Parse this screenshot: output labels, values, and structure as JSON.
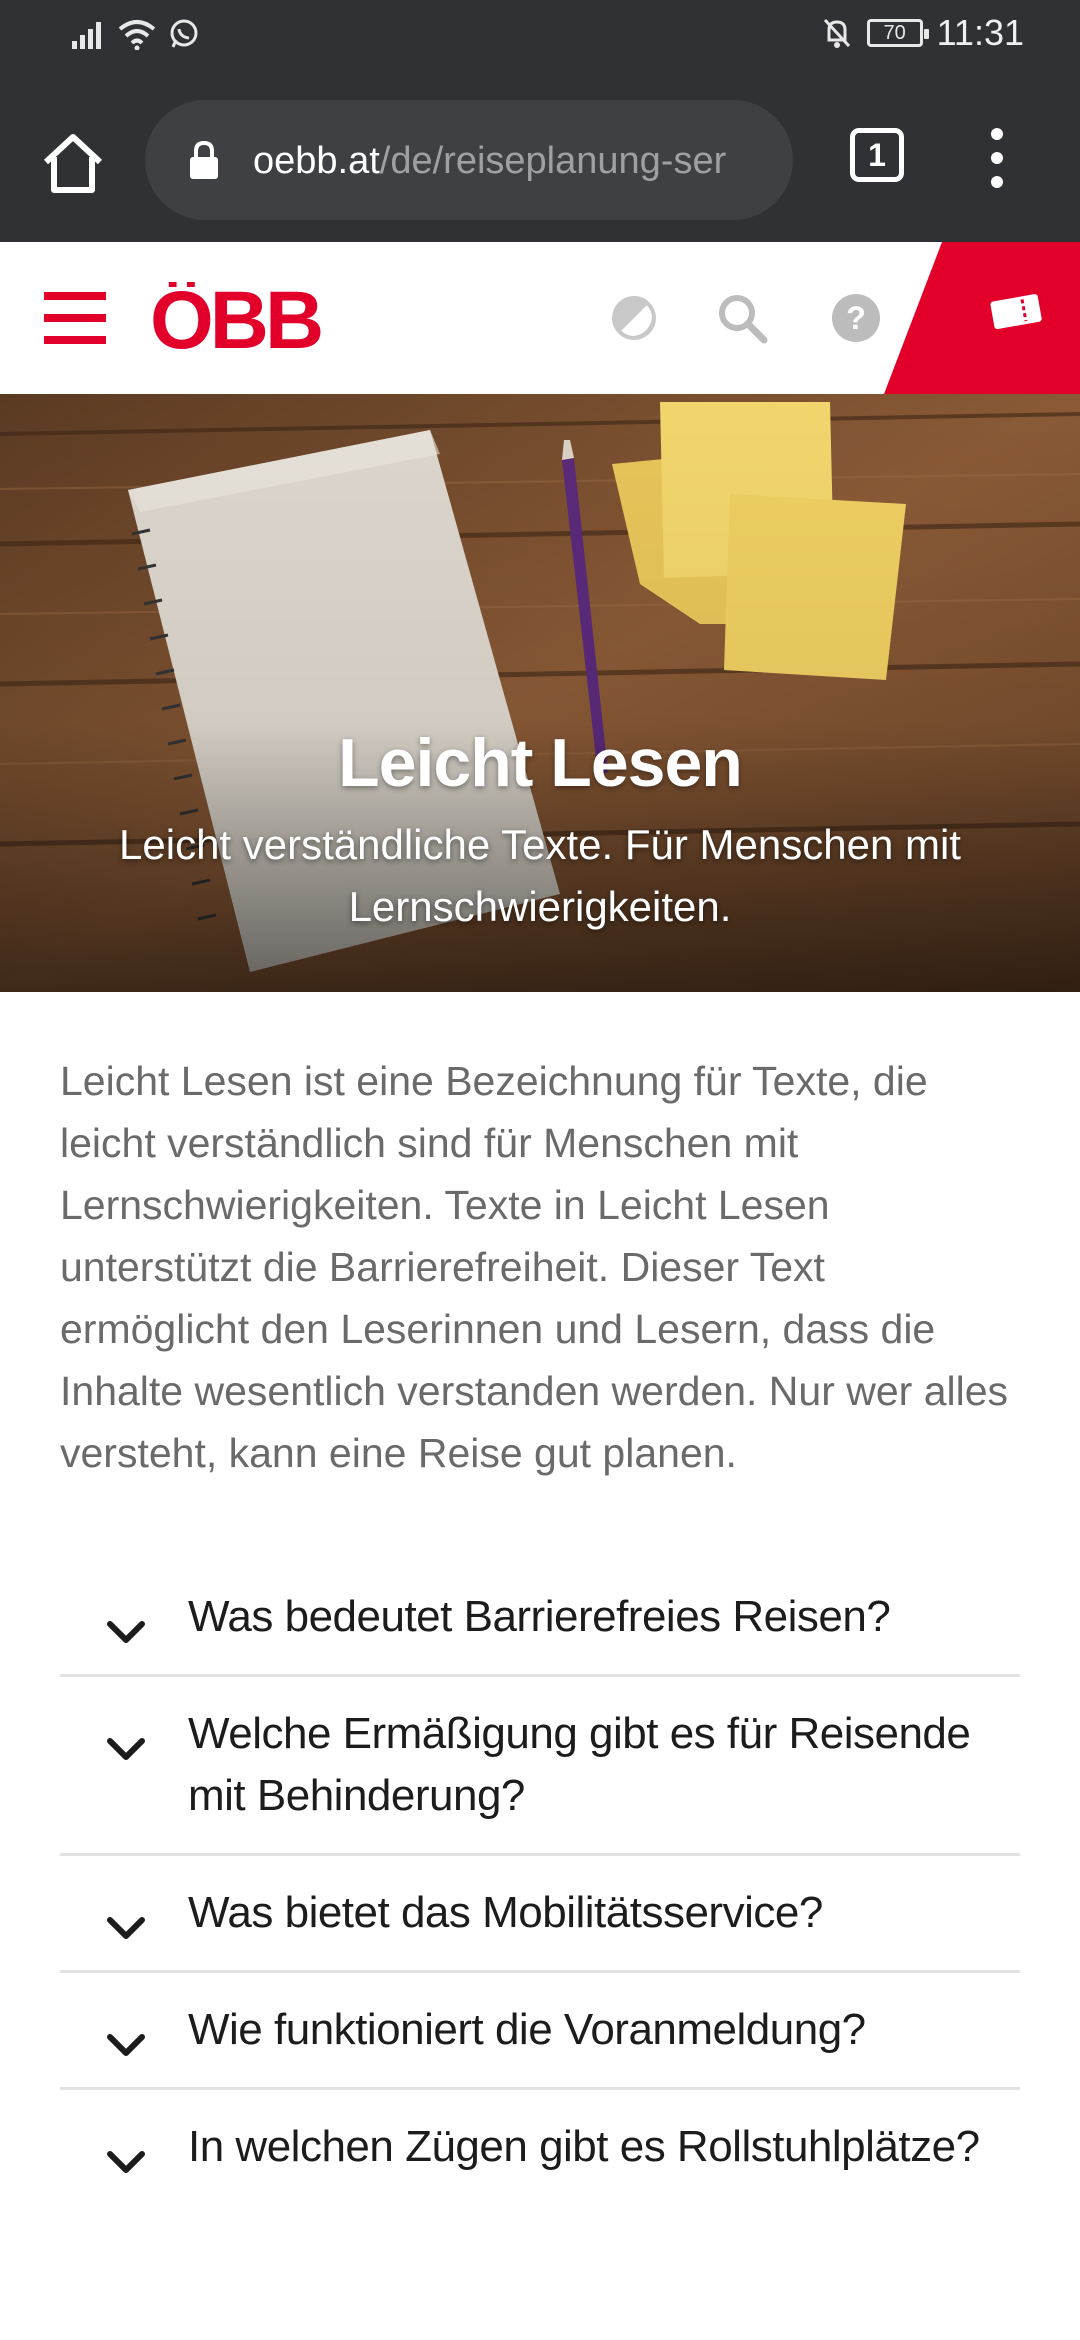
{
  "status_bar": {
    "time": "11:31",
    "battery": "70",
    "icons": [
      "signal-icon",
      "wifi-icon",
      "whatsapp-icon",
      "mute-icon",
      "battery-icon"
    ]
  },
  "browser": {
    "url_host": "oebb.at",
    "url_path": "/de/reiseplanung-ser",
    "tab_count": "1"
  },
  "site_header": {
    "logo_text": "ÖBB",
    "brand_color": "#e2002a",
    "icons": [
      "menu-icon",
      "contrast-icon",
      "search-icon",
      "help-icon",
      "ticket-icon"
    ]
  },
  "hero": {
    "title": "Leicht Lesen",
    "subtitle": "Leicht verständliche Texte. Für Menschen mit Lernschwierigkeiten."
  },
  "intro": {
    "text": "Leicht Lesen ist eine Bezeichnung für Texte, die leicht verständlich sind für Menschen mit Lernschwierigkeiten. Texte in Leicht Lesen unterstützt die Barrierefreiheit. Dieser Text ermöglicht den Leserinnen und Lesern, dass die Inhalte wesentlich verstanden werden. Nur wer alles versteht, kann eine Reise gut planen."
  },
  "faq": {
    "items": [
      {
        "label": "Was bedeutet Barrierefreies Reisen?"
      },
      {
        "label": "Welche Ermäßigung gibt es für Reisende mit Behinderung?"
      },
      {
        "label": "Was bietet das Mobilitätsservice?"
      },
      {
        "label": "Wie funktioniert die Voranmeldung?"
      },
      {
        "label": "In welchen Zügen gibt es Rollstuhlplätze?"
      }
    ]
  }
}
